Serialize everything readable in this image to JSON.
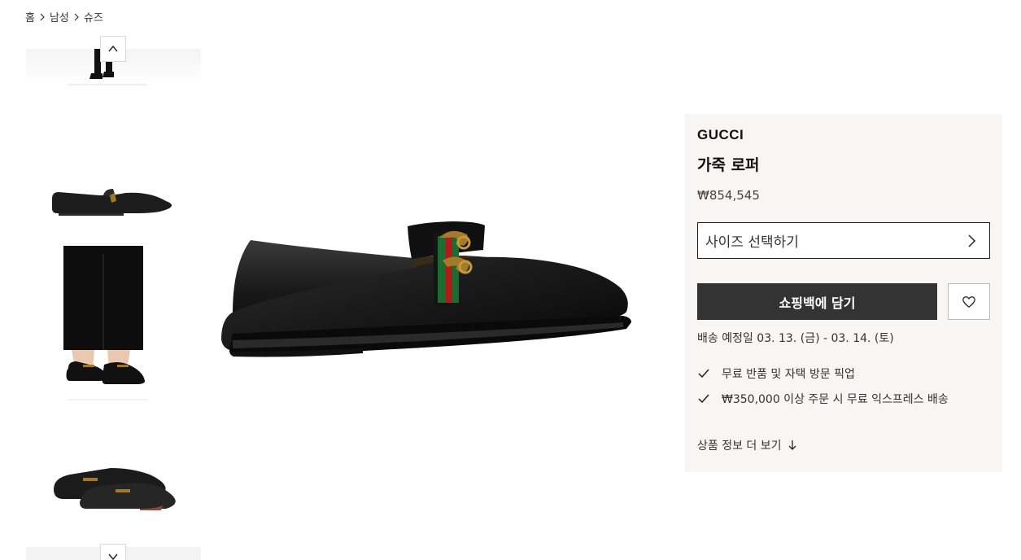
{
  "breadcrumb": {
    "items": [
      "홈",
      "남성",
      "슈즈"
    ]
  },
  "product": {
    "brand": "GUCCI",
    "name": "가죽 로퍼",
    "price": "₩854,545",
    "size_select_label": "사이즈 선택하기",
    "add_to_bag_label": "쇼핑백에 담기",
    "delivery": "배송 예정일 03. 13. (금) - 03. 14. (토)",
    "benefits": [
      "무료 반품 및 자택 방문 픽업",
      "₩350,000 이상 주문 시 무료 익스프레스 배송"
    ],
    "more_info_label": "상품 정보 더 보기"
  },
  "colors": {
    "panel_bg": "#f7f6f5",
    "button_dark": "#333333"
  },
  "icons": [
    "chevron-right-icon",
    "chevron-up-icon",
    "chevron-down-icon",
    "heart-icon",
    "check-icon",
    "arrow-down-icon"
  ]
}
